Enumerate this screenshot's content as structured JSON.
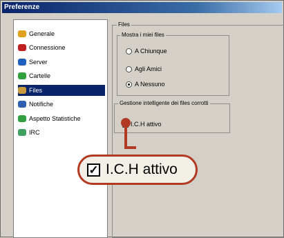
{
  "window": {
    "title": "Preferenze"
  },
  "sidebar": {
    "items": [
      {
        "label": "Generale",
        "icon": "settings-icon",
        "color": "#e0a020"
      },
      {
        "label": "Connessione",
        "icon": "connection-icon",
        "color": "#c02020"
      },
      {
        "label": "Server",
        "icon": "server-icon",
        "color": "#2060c0"
      },
      {
        "label": "Cartelle",
        "icon": "folder-icon",
        "color": "#30a040"
      },
      {
        "label": "Files",
        "icon": "files-icon",
        "color": "#c89c3c",
        "selected": true
      },
      {
        "label": "Notifiche",
        "icon": "notifications-icon",
        "color": "#3060b0"
      },
      {
        "label": "Aspetto Statistiche",
        "icon": "statistics-icon",
        "color": "#30a040"
      },
      {
        "label": "IRC",
        "icon": "irc-icon",
        "color": "#40a060"
      }
    ]
  },
  "main": {
    "files_group_title": "Files",
    "share_group": {
      "title": "Mostra i miei files",
      "options": [
        {
          "label": "A Chiunque",
          "selected": false
        },
        {
          "label": "Agli Amici",
          "selected": false
        },
        {
          "label": "A Nessuno",
          "selected": true
        }
      ]
    },
    "ich_group": {
      "title": "Gestione intelligente dei files corrotti",
      "checkbox_label": "I.C.H attivo",
      "checked": true
    }
  },
  "callout": {
    "label": "I.C.H attivo",
    "checked": true,
    "accent": "#b23a22"
  }
}
